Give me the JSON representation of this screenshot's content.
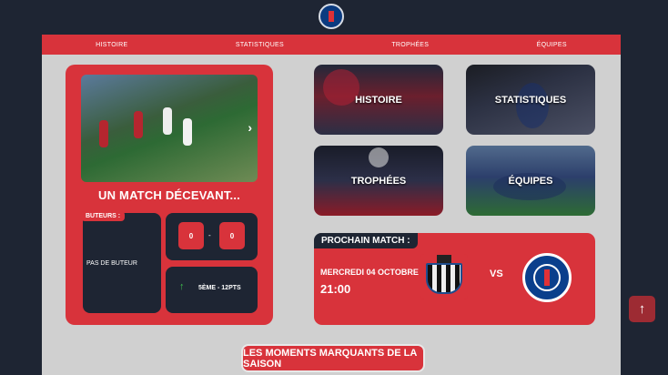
{
  "nav": {
    "items": [
      "HISTOIRE",
      "STATISTIQUES",
      "TROPHÉES",
      "ÉQUIPES"
    ]
  },
  "last_match": {
    "title": "UN MATCH DÉCEVANT...",
    "scorers_label": "BUTEURS :",
    "scorers_text": "PAS DE BUTEUR",
    "score_home": "0",
    "score_separator": "-",
    "score_away": "0",
    "ranking": "5ÈME - 12PTS",
    "carousel_next_icon": "chevron-right-icon"
  },
  "tiles": {
    "histoire": "HISTOIRE",
    "statistiques": "STATISTIQUES",
    "trophees": "TROPHÉES",
    "equipes": "ÉQUIPES"
  },
  "next_match": {
    "label": "PROCHAIN MATCH :",
    "date": "MERCREDI 04 OCTOBRE",
    "time": "21:00",
    "vs": "VS"
  },
  "moments_button": "LES MOMENTS MARQUANTS DE LA SAISON",
  "colors": {
    "brand_red": "#d8333b",
    "navy": "#1e2533",
    "background": "#d0d0d0"
  }
}
